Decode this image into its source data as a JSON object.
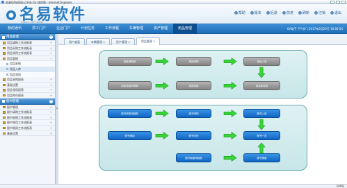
{
  "window": {
    "title": "名易OA协同办公平台 for 体验版 - Internet Explorer"
  },
  "header": {
    "logo_text": "名易软件",
    "logo_sub": "MINGYI SOFTWARE",
    "links": [
      "帮助",
      "版本",
      "后退",
      "前进",
      "刷新",
      "注销",
      "退出"
    ]
  },
  "nav": {
    "items": [
      "我的通讯",
      "员工门户",
      "企业门户",
      "计划任务",
      "工作流程",
      "车辆管理",
      "资产管理",
      "用品管理"
    ],
    "active_index": 7,
    "user_info": "OA助手 下午好 | 2017年6月29日 16:00:54"
  },
  "sidebar": {
    "section1_title": "用品管理",
    "section1_items": [
      {
        "label": "用品请购工作流报表",
        "type": "item"
      },
      {
        "label": "用品采购工作流报表",
        "type": "item"
      },
      {
        "label": "用品领用工作流报表",
        "type": "item"
      },
      {
        "label": "用品管理",
        "type": "item"
      },
      {
        "label": "用品采购",
        "type": "sub"
      },
      {
        "label": "用品入库",
        "type": "sub"
      },
      {
        "label": "用品领用",
        "type": "sub"
      },
      {
        "label": "用品采购报表",
        "type": "item"
      },
      {
        "label": "基础设置",
        "type": "item"
      },
      {
        "label": "用品领用报表",
        "type": "item"
      },
      {
        "label": "用品库存报表",
        "type": "item"
      }
    ],
    "section2_title": "图书管理",
    "section2_items": [
      {
        "label": "图书管理",
        "type": "item"
      },
      {
        "label": "图书请购工作流报表",
        "type": "item"
      },
      {
        "label": "图书采购工作流报表",
        "type": "item"
      },
      {
        "label": "图书领用工作流报表",
        "type": "item"
      },
      {
        "label": "图书借阅工作流报表",
        "type": "item"
      },
      {
        "label": "基础设置",
        "type": "item"
      }
    ]
  },
  "tabs": [
    {
      "label": "用户桌面"
    },
    {
      "label": "车辆管理"
    },
    {
      "label": "资产管理"
    },
    {
      "label": "用品管理"
    }
  ],
  "flow_top": {
    "boxes": [
      "用品请购单",
      "用品采购",
      "用品入库",
      "用品领用申请单",
      "用品领用",
      "用品库存表"
    ]
  },
  "flow_bottom": {
    "boxes": [
      "图书请购明细表",
      "图书采购",
      "图书入库",
      "图书借阅",
      "图书归还",
      "图书一览",
      "图书报废明细表",
      "图书报废"
    ]
  },
  "status": {
    "zoom": "100%"
  }
}
